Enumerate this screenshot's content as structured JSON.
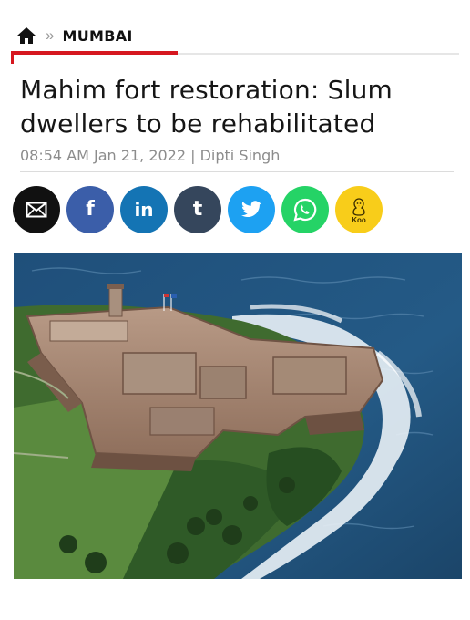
{
  "breadcrumb": {
    "home_icon": "home-icon",
    "separator": "»",
    "section": "MUMBAI"
  },
  "article": {
    "headline": "Mahim fort restoration: Slum dwellers to be rehabilitated",
    "meta": "08:54 AM Jan 21, 2022 | Dipti Singh"
  },
  "share": {
    "buttons": [
      {
        "name": "email",
        "icon": "envelope-icon",
        "color": "#111111"
      },
      {
        "name": "facebook",
        "label": "f",
        "color": "#3b5ea9"
      },
      {
        "name": "linkedin",
        "label": "in",
        "color": "#1474b4"
      },
      {
        "name": "tumblr",
        "label": "t",
        "color": "#35465c"
      },
      {
        "name": "twitter",
        "icon": "twitter-bird-icon",
        "color": "#1da1f2"
      },
      {
        "name": "whatsapp",
        "icon": "whatsapp-icon",
        "color": "#25d366"
      },
      {
        "name": "koo",
        "icon": "koo-bird-icon",
        "label": "Koo",
        "color": "#f8cd1a"
      }
    ]
  },
  "image": {
    "subject": "aerial-photo-coastal-fort"
  },
  "colors": {
    "accent": "#d6171f",
    "meta_text": "#8c8c8c"
  }
}
